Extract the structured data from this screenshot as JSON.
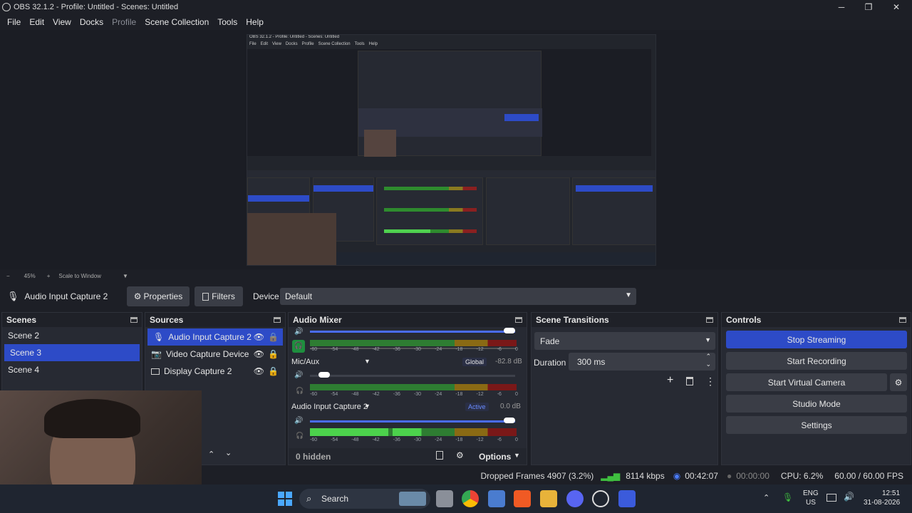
{
  "window": {
    "title": "OBS 32.1.2 - Profile: Untitled - Scenes: Untitled",
    "min": "─",
    "max": "❐",
    "close": "✕"
  },
  "menu": [
    "File",
    "Edit",
    "View",
    "Docks",
    "Profile",
    "Scene Collection",
    "Tools",
    "Help"
  ],
  "zoom": {
    "minus": "−",
    "value": "45%",
    "plus": "+",
    "mode": "Scale to Window"
  },
  "source_bar": {
    "name": "Audio Input Capture 2",
    "properties": "Properties",
    "filters": "Filters",
    "device_label": "Device",
    "device_value": "Default"
  },
  "scenes": {
    "title": "Scenes",
    "items": [
      "Scene 2",
      "Scene 3",
      "Scene 4"
    ],
    "selected": 1
  },
  "sources": {
    "title": "Sources",
    "items": [
      {
        "label": "Audio Input Capture 2",
        "icon": "mic-icon"
      },
      {
        "label": "Video Capture Device",
        "icon": "camera-icon"
      },
      {
        "label": "Display Capture 2",
        "icon": "monitor-icon"
      }
    ]
  },
  "mixer": {
    "title": "Audio Mixer",
    "scale": [
      "-60",
      "-54",
      "-48",
      "-42",
      "-36",
      "-30",
      "-24",
      "-18",
      "-12",
      "-6",
      "0"
    ],
    "channels": [
      {
        "name": "Mic/Aux",
        "badge": "Global",
        "db": "-82.8 dB",
        "volume": 0.07
      },
      {
        "name": "Audio Input Capture 2",
        "badge": "Active",
        "db": "0.0 dB",
        "volume": 1.0
      }
    ],
    "hidden": "0 hidden",
    "options": "Options"
  },
  "transitions": {
    "title": "Scene Transitions",
    "value": "Fade",
    "duration_label": "Duration",
    "duration": "300 ms"
  },
  "controls": {
    "title": "Controls",
    "buttons": [
      "Stop Streaming",
      "Start Recording",
      "Start Virtual Camera",
      "Studio Mode",
      "Settings"
    ]
  },
  "status": {
    "dropped": "Dropped Frames 4907 (3.2%)",
    "kbps": "8114 kbps",
    "stream_time": "00:42:07",
    "rec_time": "00:00:00",
    "cpu": "CPU: 6.2%",
    "fps": "60.00 / 60.00 FPS"
  },
  "taskbar": {
    "search": "Search",
    "lang1": "ENG",
    "lang2": "US",
    "time": "12:51",
    "date": "31-08-2026"
  },
  "nested_mini": {
    "title": "OBS 32.1.2 - Profile: Untitled - Scenes: Untitled",
    "menu": [
      "File",
      "Edit",
      "View",
      "Docks",
      "Profile",
      "Scene Collection",
      "Tools",
      "Help"
    ]
  }
}
